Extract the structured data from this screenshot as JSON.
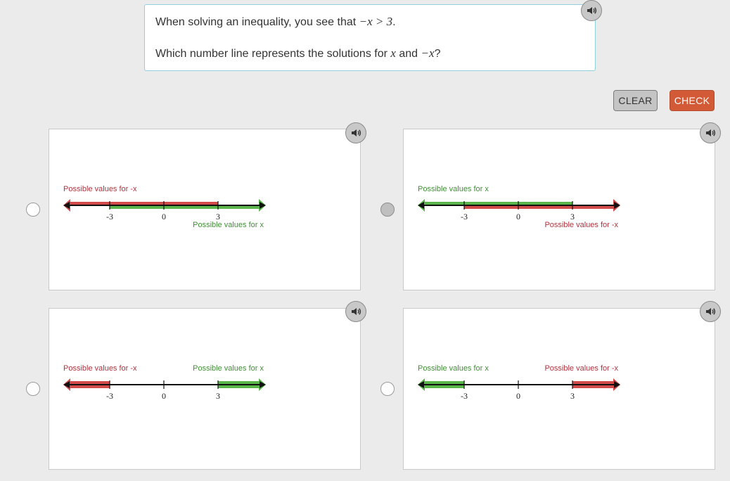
{
  "question": {
    "line1_prefix": "When solving an inequality, you see that ",
    "line1_math": "−x > 3",
    "line1_suffix": ".",
    "line2_prefix": "Which number line represents the solutions for ",
    "line2_math_x": "x",
    "line2_and": " and ",
    "line2_math_negx": "−x",
    "line2_suffix": "?"
  },
  "buttons": {
    "clear": "CLEAR",
    "check": "CHECK"
  },
  "ticks": [
    "-3",
    "0",
    "3"
  ],
  "colors": {
    "red": "#d24b4b",
    "red_text": "#b0333f",
    "green": "#5ab54b",
    "green_text": "#3f8f34"
  },
  "options": [
    {
      "selected": false,
      "left_label": "Possible values for -x",
      "left_label_color": "red",
      "right_label": "Possible values for x",
      "right_label_color": "green",
      "segments": [
        {
          "from": "left-arrow",
          "to": "3",
          "color": "red"
        },
        {
          "from": "-3",
          "to": "right-arrow",
          "color": "green"
        }
      ]
    },
    {
      "selected": true,
      "left_label": "Possible values for x",
      "left_label_color": "green",
      "right_label": "Possible values for -x",
      "right_label_color": "red",
      "segments": [
        {
          "from": "left-arrow",
          "to": "3",
          "color": "green"
        },
        {
          "from": "-3",
          "to": "right-arrow",
          "color": "red"
        }
      ]
    },
    {
      "selected": false,
      "left_label": "Possible values for -x",
      "left_label_color": "red",
      "right_label": "Possible values for x",
      "right_label_color": "green",
      "segments": [
        {
          "from": "left-arrow",
          "to": "-3",
          "color": "red"
        },
        {
          "from": "3",
          "to": "right-arrow",
          "color": "green"
        }
      ]
    },
    {
      "selected": false,
      "left_label": "Possible values for x",
      "left_label_color": "green",
      "right_label": "Possible values for -x",
      "right_label_color": "red",
      "segments": [
        {
          "from": "left-arrow",
          "to": "-3",
          "color": "green"
        },
        {
          "from": "3",
          "to": "right-arrow",
          "color": "red"
        }
      ]
    }
  ],
  "icons": {
    "speaker": "speaker-icon"
  }
}
